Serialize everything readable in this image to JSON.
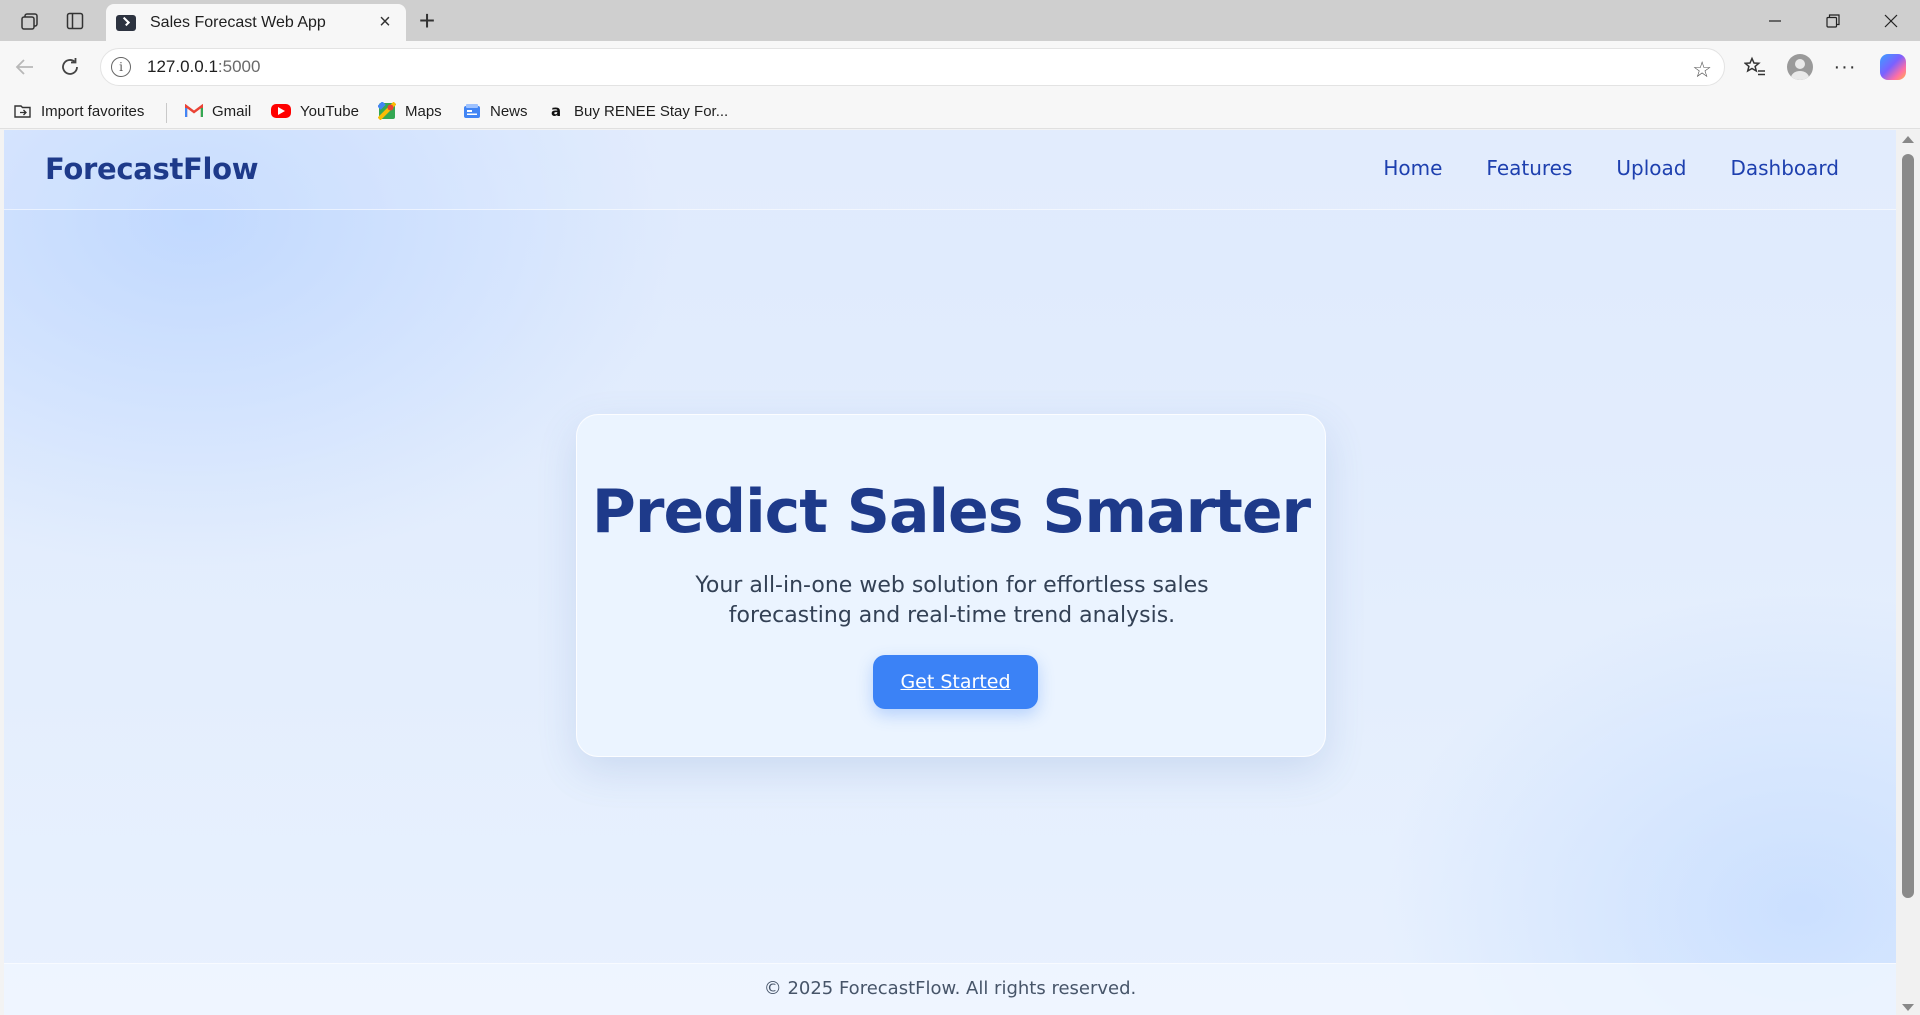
{
  "browser": {
    "tab": {
      "title": "Sales Forecast Web App"
    },
    "address": {
      "host": "127.0.0.1",
      "port": ":5000"
    },
    "bookmarks": [
      {
        "label": "Import favorites",
        "icon": "import-favorites-icon"
      },
      {
        "label": "Gmail",
        "icon": "gmail-icon"
      },
      {
        "label": "YouTube",
        "icon": "youtube-icon"
      },
      {
        "label": "Maps",
        "icon": "maps-icon"
      },
      {
        "label": "News",
        "icon": "news-icon"
      },
      {
        "label": "Buy RENEE Stay For...",
        "icon": "amazon-icon"
      }
    ]
  },
  "site": {
    "brand": "ForecastFlow",
    "nav": [
      "Home",
      "Features",
      "Upload",
      "Dashboard"
    ],
    "hero": {
      "title": "Predict Sales Smarter",
      "subtitle": "Your all-in-one web solution for effortless sales forecasting and real-time trend analysis.",
      "cta": "Get Started"
    },
    "footer": "© 2025 ForecastFlow. All rights reserved."
  },
  "colors": {
    "brand": "#1e3a8a",
    "nav_link": "#1e40af",
    "cta_bg": "#3b82f6",
    "cta_text": "#ffffff"
  }
}
